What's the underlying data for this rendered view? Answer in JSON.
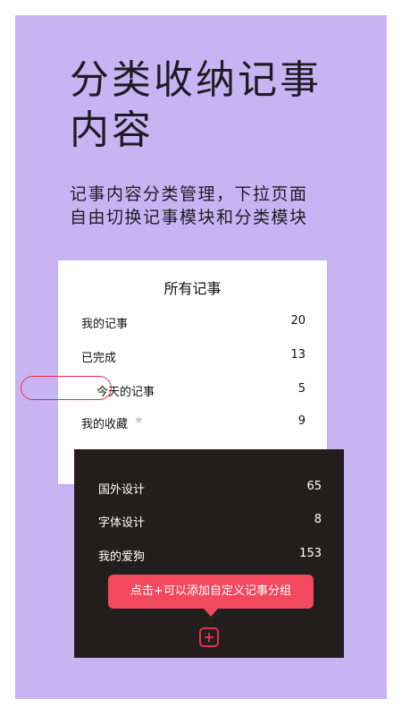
{
  "headline": {
    "line1": "分类收纳记事",
    "line2": "内容"
  },
  "subtitle": {
    "line1": "记事内容分类管理，下拉页面",
    "line2": "自由切换记事模块和分类模块"
  },
  "all_notes": {
    "title": "所有记事",
    "items": [
      {
        "label": "我的记事",
        "count": "20"
      },
      {
        "label": "已完成",
        "count": "13"
      },
      {
        "label": "今天的记事",
        "count": "5"
      },
      {
        "label": "我的收藏",
        "count": "9",
        "icon": "star-icon"
      }
    ]
  },
  "categories": {
    "items": [
      {
        "label": "国外设计",
        "count": "65"
      },
      {
        "label": "字体设计",
        "count": "8"
      },
      {
        "label": "我的爱狗",
        "count": "153"
      }
    ],
    "tooltip": "点击+可以添加自定义记事分组",
    "add_icon": "plus-square-icon"
  },
  "colors": {
    "background": "#c9b4f3",
    "accent": "#e2304a",
    "tooltip": "#f2495f",
    "dark_card": "#231d1e"
  }
}
